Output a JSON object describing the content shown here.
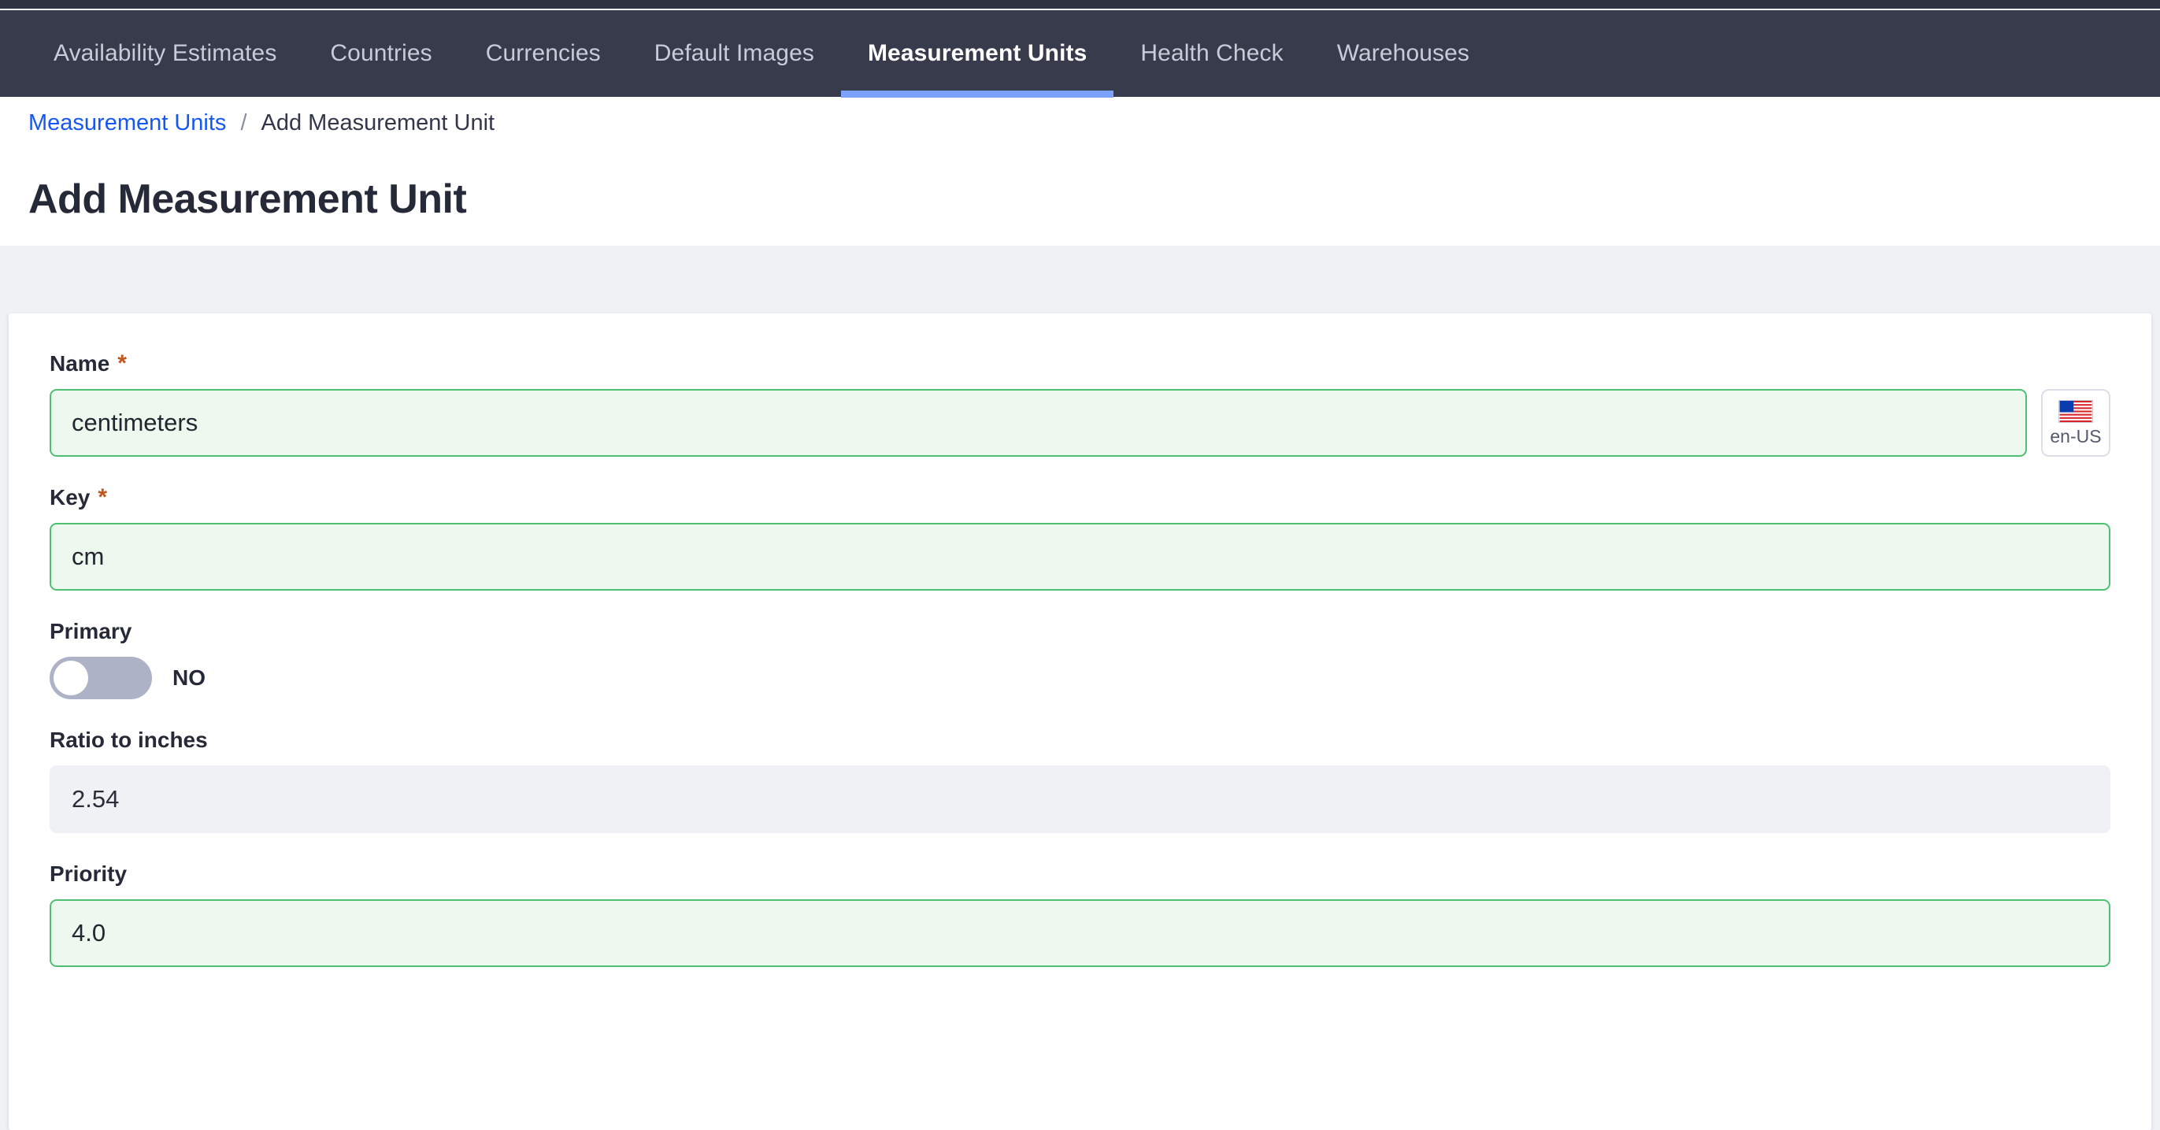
{
  "nav": {
    "items": [
      {
        "label": "Availability Estimates",
        "active": false
      },
      {
        "label": "Countries",
        "active": false
      },
      {
        "label": "Currencies",
        "active": false
      },
      {
        "label": "Default Images",
        "active": false
      },
      {
        "label": "Measurement Units",
        "active": true
      },
      {
        "label": "Health Check",
        "active": false
      },
      {
        "label": "Warehouses",
        "active": false
      }
    ],
    "active_underline_color": "#7da2fb",
    "background_color": "#383b4b"
  },
  "breadcrumb": {
    "parent": "Measurement Units",
    "separator": "/",
    "current": "Add Measurement Unit",
    "link_color": "#1657f0"
  },
  "page": {
    "title": "Add Measurement Unit"
  },
  "form": {
    "name": {
      "label": "Name",
      "required_marker": "*",
      "value": "centimeters",
      "placeholder": ""
    },
    "language_button": {
      "code": "en-US",
      "flag": "us-flag-icon"
    },
    "key": {
      "label": "Key",
      "required_marker": "*",
      "value": "cm",
      "placeholder": ""
    },
    "primary": {
      "label": "Primary",
      "state_text": "NO",
      "checked": false
    },
    "ratio_to_inches": {
      "label": "Ratio to inches",
      "value": "2.54",
      "readonly": true
    },
    "priority": {
      "label": "Priority",
      "value": "4.0",
      "placeholder": ""
    }
  },
  "colors": {
    "valid_border": "#4fc072",
    "valid_background": "#edf8ef",
    "required_star": "#c0561c",
    "page_background": "#eff1f5"
  }
}
